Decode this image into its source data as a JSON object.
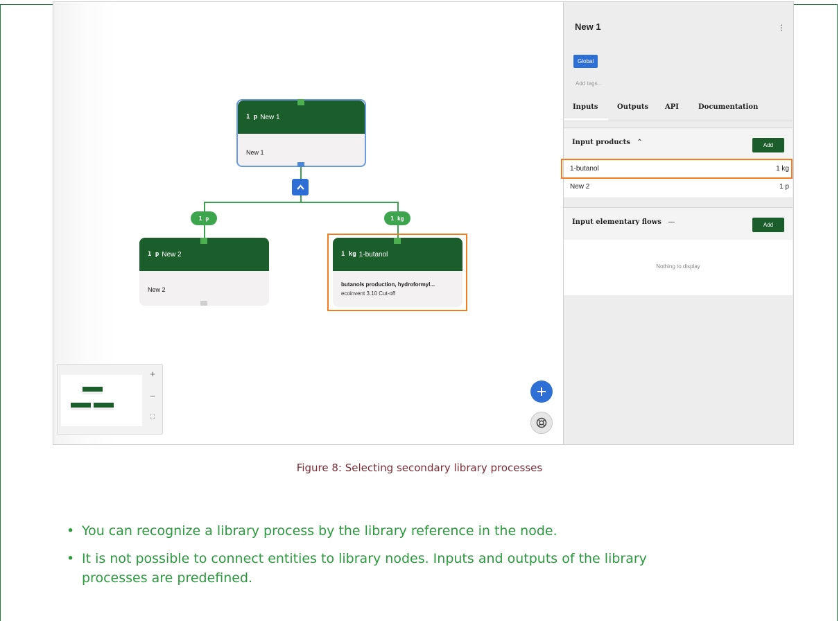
{
  "graph": {
    "root": {
      "qty": "1 p",
      "name": "New 1",
      "body": "New 1"
    },
    "left_pill": "1 p",
    "right_pill": "1 kg",
    "left": {
      "qty": "1 p",
      "name": "New 2",
      "body": "New 2"
    },
    "right": {
      "qty": "1 kg",
      "name": "1-butanol",
      "body_line1": "butanols production, hydroformyl...",
      "body_line2": "ecoinvent 3.10 Cut-off"
    }
  },
  "minimap": {
    "zoom_in": "+",
    "zoom_out": "−",
    "fit": "⛶"
  },
  "sidebar": {
    "title": "New 1",
    "menu": "⋮",
    "badge": "Global",
    "tags_placeholder": "Add tags...",
    "tabs": [
      "Inputs",
      "Outputs",
      "API",
      "Documentation"
    ],
    "input_products": {
      "title": "Input products",
      "toggle": "^",
      "add": "Add",
      "rows": [
        {
          "name": "1-butanol",
          "qty": "1 kg"
        },
        {
          "name": "New 2",
          "qty": "1 p"
        }
      ]
    },
    "elementary": {
      "title": "Input elementary flows",
      "toggle": "—",
      "add": "Add",
      "empty": "Nothing to display"
    }
  },
  "colors": {
    "node_header": "#1b5e2b",
    "edge": "#3aa24f",
    "highlight": "#f07d1f",
    "accent": "#2e6fd6"
  },
  "caption": "Figure 8: Selecting secondary library processes",
  "bullets": [
    "You can recognize a library process by the library reference in the node.",
    "It is not possible to connect entities to library nodes. Inputs and outputs of the library",
    "processes are predefined."
  ]
}
